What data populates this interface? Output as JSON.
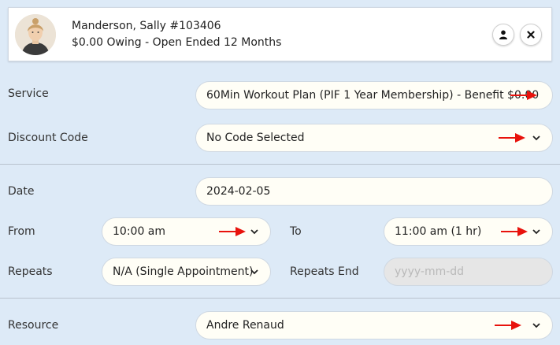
{
  "client": {
    "name": "Manderson, Sally #103406",
    "status": "$0.00 Owing - Open Ended 12 Months",
    "profile_icon": "person-icon",
    "close_icon": "close-icon"
  },
  "form": {
    "service": {
      "label": "Service",
      "value": "60Min Workout Plan (PIF 1 Year Membership) - Benefit $0.00"
    },
    "discount": {
      "label": "Discount Code",
      "value": "No Code Selected"
    },
    "date": {
      "label": "Date",
      "value": "2024-02-05"
    },
    "from": {
      "label": "From",
      "value": "10:00 am"
    },
    "to": {
      "label": "To",
      "value": "11:00 am (1 hr)"
    },
    "repeats": {
      "label": "Repeats",
      "value": "N/A (Single Appointment)"
    },
    "repeats_end": {
      "label": "Repeats End",
      "placeholder": "yyyy-mm-dd"
    },
    "resource": {
      "label": "Resource",
      "value": "Andre Renaud"
    }
  },
  "colors": {
    "background": "#ddeaf7",
    "field": "#fffef6",
    "annotation_arrow": "#e8120c"
  }
}
